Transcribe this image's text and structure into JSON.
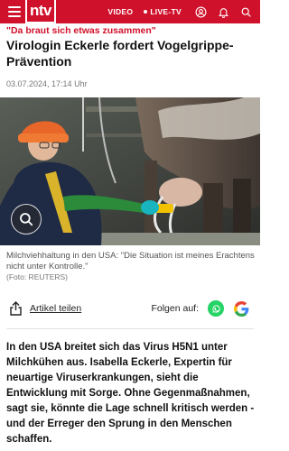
{
  "header": {
    "logo_text": "ntv",
    "nav_video": "VIDEO",
    "nav_live": "LIVE-TV",
    "brand_color": "#d0112b",
    "icons": [
      "menu-icon",
      "user-icon",
      "bell-icon",
      "search-icon"
    ]
  },
  "article": {
    "kicker": "\"Da braut sich etwas zusammen\"",
    "headline": "Virologin Eckerle fordert Vogelgrippe-Prävention",
    "date": "03.07.2024, 17:14 Uhr",
    "image_caption": "Milchviehhaltung in den USA: \"Die Situation ist meines Erachtens nicht unter Kontrolle.\"",
    "image_credit": "(Foto: REUTERS)",
    "share_label": "Artikel teilen",
    "follow_label": "Folgen auf:",
    "lead": "In den USA breitet sich das Virus H5N1 unter Milchkühen aus. Isabella Eckerle, Expertin für neuartige Viruserkrankungen, sieht die Entwicklung mit Sorge. Ohne Gegenmaßnahmen, sagt sie, könnte die Lage schnell kritisch werden - und der Erreger den Sprung in den Menschen schaffen."
  }
}
